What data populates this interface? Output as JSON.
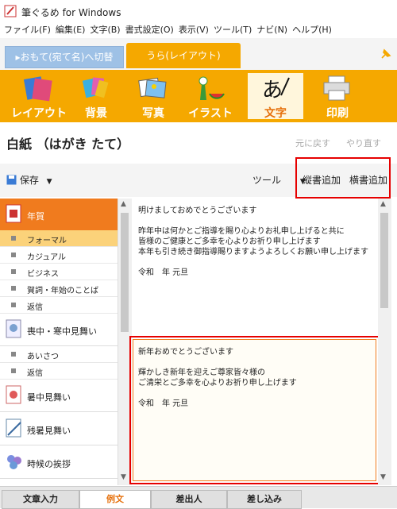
{
  "window": {
    "title": "筆ぐるめ for Windows"
  },
  "menu": [
    "ファイル(F)",
    "編集(E)",
    "文字(B)",
    "書式設定(O)",
    "表示(V)",
    "ツール(T)",
    "ナビ(N)",
    "ヘルプ(H)"
  ],
  "mode_switch": "▸おもて(宛て名)へ切替",
  "active_side_tab": "うら(レイアウト)",
  "toolbar": {
    "layout": "レイアウト",
    "background": "背景",
    "photo": "写真",
    "illust": "イラスト",
    "text": "文字",
    "print": "印刷"
  },
  "header": {
    "title": "白紙 （はがき たて）",
    "undo": "元に戻す",
    "redo": "やり直す"
  },
  "actions": {
    "save": "保存",
    "tools": "ツール",
    "add_vertical": "縦書追加",
    "add_horizontal": "横書追加"
  },
  "sidebar": {
    "cat1": "年賀",
    "cat1_subs": [
      "フォーマル",
      "カジュアル",
      "ビジネス",
      "賀詞・年始のことば",
      "返信"
    ],
    "cat2": "喪中・寒中見舞い",
    "cat2_subs": [
      "あいさつ",
      "返信"
    ],
    "cat3": "暑中見舞い",
    "cat4": "残暑見舞い",
    "cat5": "時候の挨拶"
  },
  "messages": {
    "m1_l1": "明けましておめでとうございます",
    "m1_l2": "昨年中は何かとご指導を賜り心よりお礼申し上げると共に",
    "m1_l3": "皆様のご健康とご多幸を心よりお祈り申し上げます",
    "m1_l4": "本年も引き続き御指導賜りますようよろしくお願い申し上げます",
    "m1_l5": "令和　年 元旦",
    "m2_l1": "新年おめでとうございます",
    "m2_l2": "輝かしき新年を迎えご尊家皆々様の",
    "m2_l3": "ご清栄とご多幸を心よりお祈り申し上げます",
    "m2_l4": "令和　年 元旦"
  },
  "bottom_tabs": [
    "文章入力",
    "例文",
    "差出人",
    "差し込み"
  ],
  "colors": {
    "accent": "#f5a800",
    "active_cat": "#f07b1e",
    "highlight": "#e60000"
  }
}
